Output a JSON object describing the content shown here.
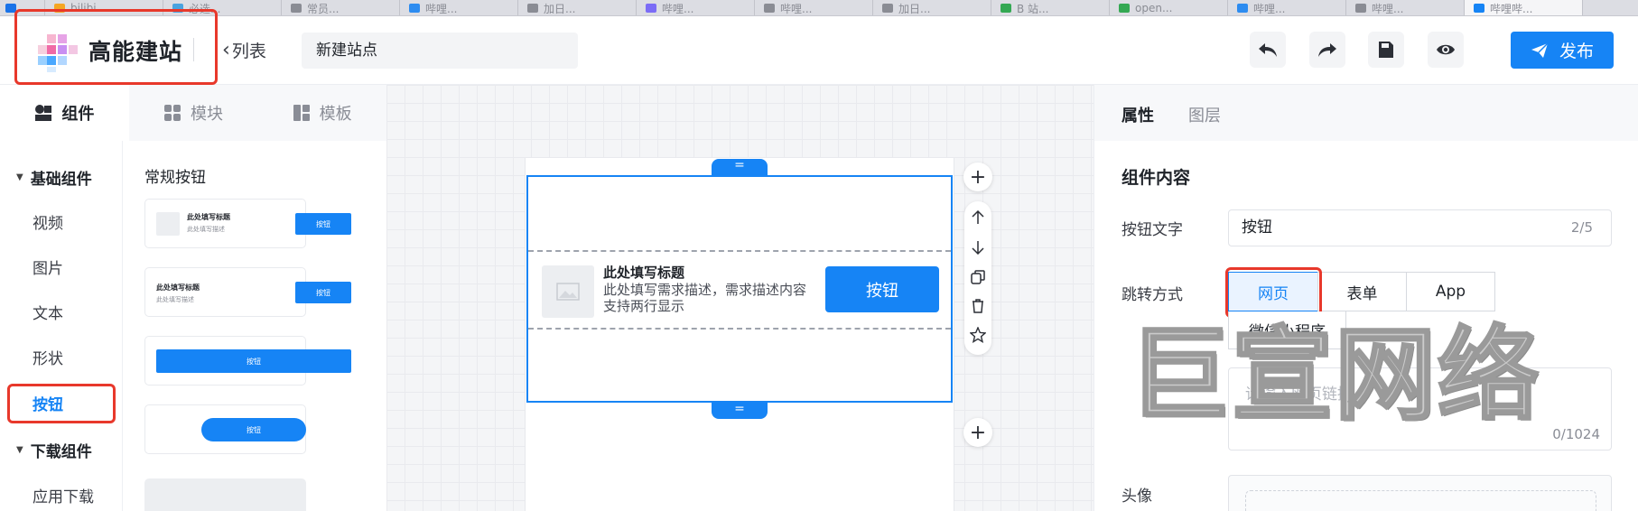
{
  "browser_tabs": [
    {
      "label": "",
      "color": "#1a73e8"
    },
    {
      "label": "bilibi...",
      "color": "#f5a623"
    },
    {
      "label": "必选...",
      "color": "#4aa3df"
    },
    {
      "label": "常员...",
      "color": "#8a8c94"
    },
    {
      "label": "哔哩...",
      "color": "#2d8cf0"
    },
    {
      "label": "加日...",
      "color": "#8a8c94"
    },
    {
      "label": "哔哩...",
      "color": "#7b6cf6"
    },
    {
      "label": "哔哩...",
      "color": "#8a8c94"
    },
    {
      "label": "加日...",
      "color": "#8a8c94"
    },
    {
      "label": "B 站...",
      "color": "#34a853"
    },
    {
      "label": "open...",
      "color": "#34a853"
    },
    {
      "label": "哔哩...",
      "color": "#2d8cf0"
    },
    {
      "label": "哔哩...",
      "color": "#8a8c94"
    },
    {
      "label": "哔哩哔...",
      "color": "#1684f5"
    }
  ],
  "header": {
    "logo_text": "高能建站",
    "back_label": "列表",
    "site_name": "新建站点",
    "publish_label": "发布"
  },
  "left_panel": {
    "tabs": [
      {
        "label": "组件",
        "icon": "component-icon"
      },
      {
        "label": "模块",
        "icon": "module-icon"
      },
      {
        "label": "模板",
        "icon": "template-icon"
      }
    ],
    "groups": [
      {
        "label": "基础组件",
        "items": [
          "视频",
          "图片",
          "文本",
          "形状",
          "按钮"
        ]
      },
      {
        "label": "下载组件",
        "items": [
          "应用下载"
        ]
      }
    ],
    "active_item": "按钮",
    "preset_title": "常规按钮",
    "presets": [
      {
        "title": "此处填写标题",
        "desc": "此处填写描述",
        "button": "按钮"
      },
      {
        "title": "此处填写标题",
        "desc": "此处填写描述",
        "button": "按钮"
      },
      {
        "button": "按钮"
      },
      {
        "button": "按钮"
      }
    ]
  },
  "canvas": {
    "component_title": "此处填写标题",
    "component_desc": "此处填写需求描述，需求描述内容支持两行显示",
    "component_button": "按钮",
    "handle_glyph": "="
  },
  "right_panel": {
    "tabs": [
      "属性",
      "图层"
    ],
    "section_title": "组件内容",
    "button_text_label": "按钮文字",
    "button_text_value": "按钮",
    "button_text_count": "2/5",
    "jump_label": "跳转方式",
    "jump_options": [
      "网页",
      "表单",
      "App",
      "微信小程序"
    ],
    "jump_selected": "网页",
    "link_placeholder": "请输入网页链接",
    "link_count": "0/1024",
    "avatar_label": "头像"
  },
  "watermark": "巨宣网络",
  "colors": {
    "accent": "#1684f5",
    "highlight": "#e8382b"
  }
}
